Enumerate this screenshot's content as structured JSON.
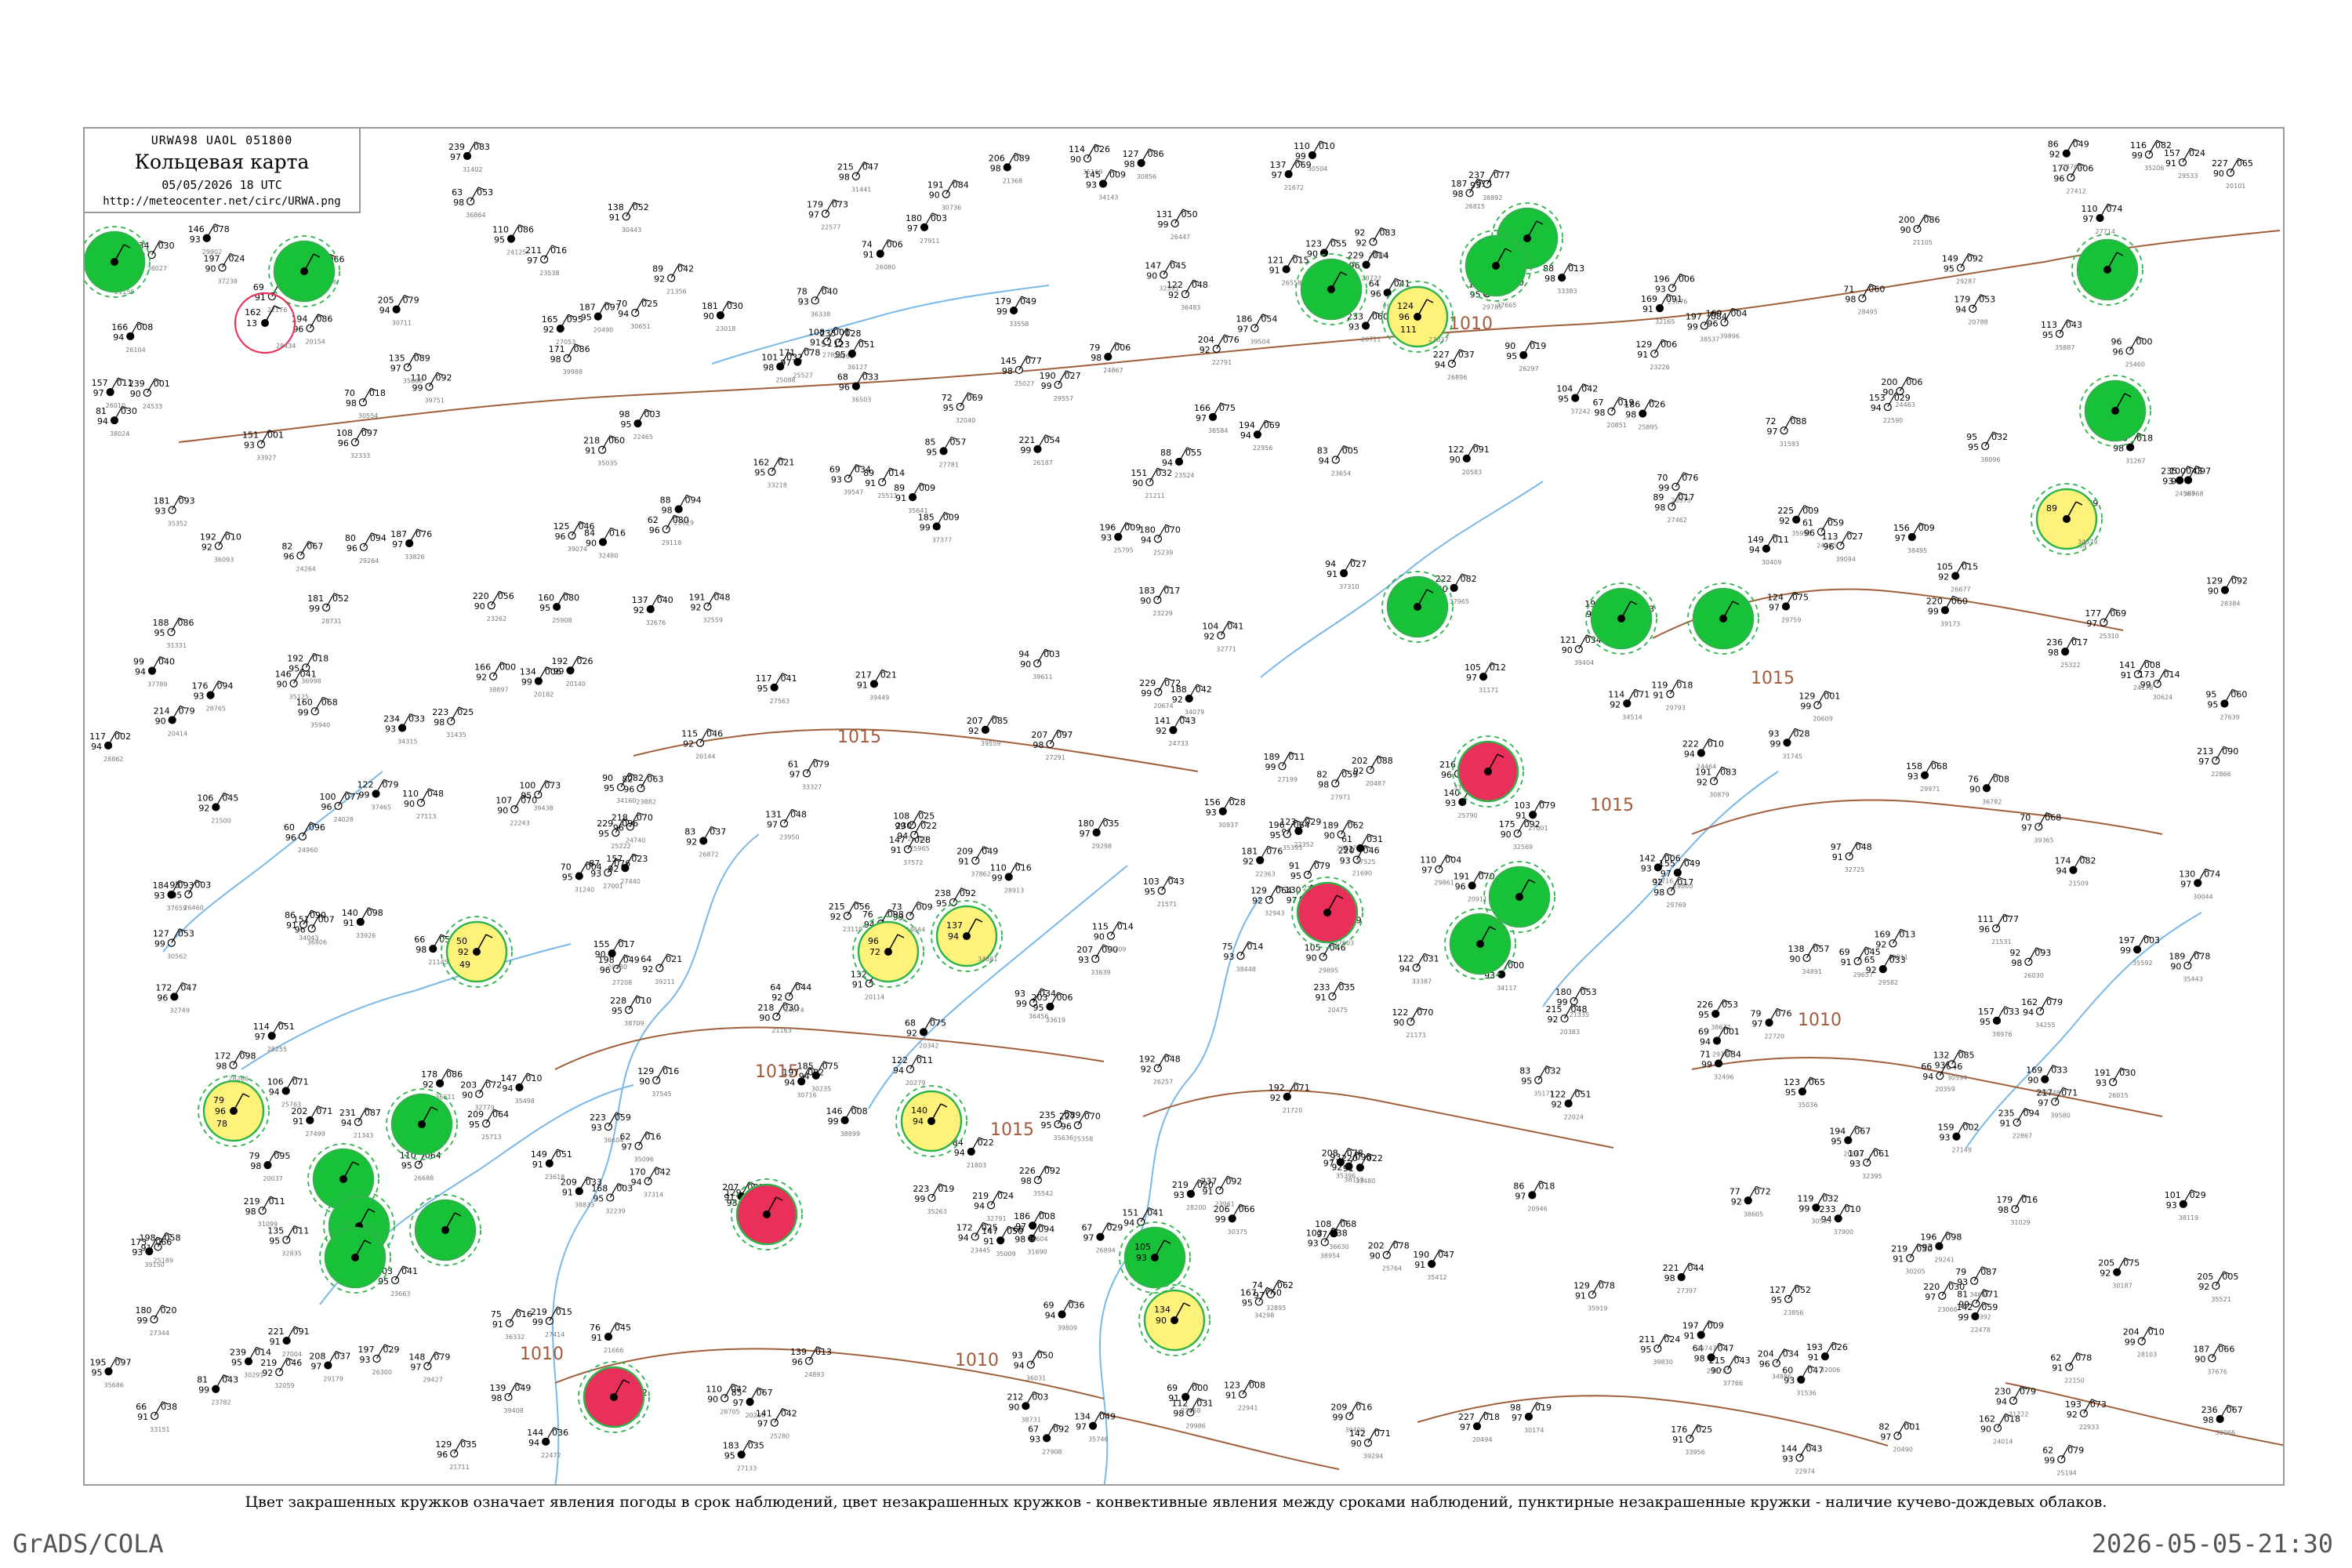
{
  "header": {
    "code": "URWA98  UAOL  051800",
    "title": "Кольцевая карта",
    "datetime": "05/05/2026 18 UTC",
    "url": "http://meteocenter.net/circ/URWA.png"
  },
  "footer": {
    "caption": "Цвет закрашенных кружков означает явления погоды в срок наблюдений, цвет незакрашенных кружков - конвективные явления между сроками наблюдений, пунктирные незакрашенные кружки - наличие кучево-дождевых облаков.",
    "credit_left": "GrADS/COLA",
    "credit_right": "2026-05-05-21:30"
  },
  "colors": {
    "isobar": "#a0603c",
    "river": "#7ab8e8",
    "rain": "#17c238",
    "ring": "#2fb34a",
    "thunder": "#e8305a",
    "fog": "#fff27a"
  },
  "isobars": [
    "1010",
    "1015",
    "1010",
    "1015",
    "1015",
    "1015",
    "1010",
    "1015",
    "1010"
  ],
  "stations": [
    {
      "name": "",
      "p": "",
      "t": "",
      "td": "",
      "type": "fill-green"
    },
    {
      "name": "",
      "p": "",
      "t": "",
      "td": "",
      "type": "fill-green"
    },
    {
      "name": "28434",
      "p": "162",
      "t": "13",
      "td": "",
      "type": "ring-red"
    },
    {
      "name": "27037",
      "p": "124",
      "t": "96",
      "td": "111",
      "type": "fill-yellow"
    },
    {
      "name": "",
      "p": "",
      "t": "",
      "td": "",
      "type": "fill-green"
    },
    {
      "name": "",
      "p": "",
      "t": "",
      "td": "",
      "type": "fill-green"
    },
    {
      "name": "",
      "p": "",
      "t": "",
      "td": "",
      "type": "fill-green"
    },
    {
      "name": "",
      "p": "",
      "t": "",
      "td": "",
      "type": "fill-green"
    },
    {
      "name": "",
      "p": "",
      "t": "",
      "td": "",
      "type": "fill-green"
    },
    {
      "name": "34579",
      "p": "89",
      "t": "",
      "td": "",
      "type": "fill-yellow"
    },
    {
      "name": "",
      "p": "",
      "t": "",
      "td": "",
      "type": "fill-green"
    },
    {
      "name": "",
      "p": "",
      "t": "",
      "td": "",
      "type": "fill-red"
    },
    {
      "name": "",
      "p": "",
      "t": "",
      "td": "",
      "type": "fill-green"
    },
    {
      "name": "",
      "p": "",
      "t": "",
      "td": "",
      "type": "fill-green"
    },
    {
      "name": "",
      "p": "50",
      "t": "92",
      "td": "49",
      "type": "fill-yellow"
    },
    {
      "name": "",
      "p": "96",
      "t": "72",
      "td": "",
      "type": "fill-yellow"
    },
    {
      "name": "34881",
      "p": "137",
      "t": "94",
      "td": "",
      "type": "fill-yellow"
    },
    {
      "name": "",
      "p": "",
      "t": "",
      "td": "",
      "type": "fill-red"
    },
    {
      "name": "",
      "p": "",
      "t": "",
      "td": "",
      "type": "fill-green"
    },
    {
      "name": "",
      "p": "79",
      "t": "96",
      "td": "78",
      "type": "fill-yellow"
    },
    {
      "name": "",
      "p": "",
      "t": "",
      "td": "",
      "type": "fill-green"
    },
    {
      "name": "",
      "p": "",
      "t": "",
      "td": "",
      "type": "fill-green"
    },
    {
      "name": "",
      "p": "",
      "t": "",
      "td": "",
      "type": "fill-green"
    },
    {
      "name": "",
      "p": "",
      "t": "",
      "td": "",
      "type": "fill-green"
    },
    {
      "name": "",
      "p": "",
      "t": "",
      "td": "",
      "type": "fill-red"
    },
    {
      "name": "",
      "p": "140",
      "t": "94",
      "td": "",
      "type": "fill-yellow"
    },
    {
      "name": "",
      "p": "105",
      "t": "93",
      "td": "",
      "type": "fill-green"
    },
    {
      "name": "",
      "p": "134",
      "t": "90",
      "td": "",
      "type": "fill-yellow"
    },
    {
      "name": "",
      "p": "",
      "t": "",
      "td": "",
      "type": "fill-green"
    },
    {
      "name": "",
      "p": "",
      "t": "",
      "td": "",
      "type": "fill-red"
    },
    {
      "name": "",
      "p": "",
      "t": "",
      "td": "",
      "type": "fill-green"
    }
  ]
}
